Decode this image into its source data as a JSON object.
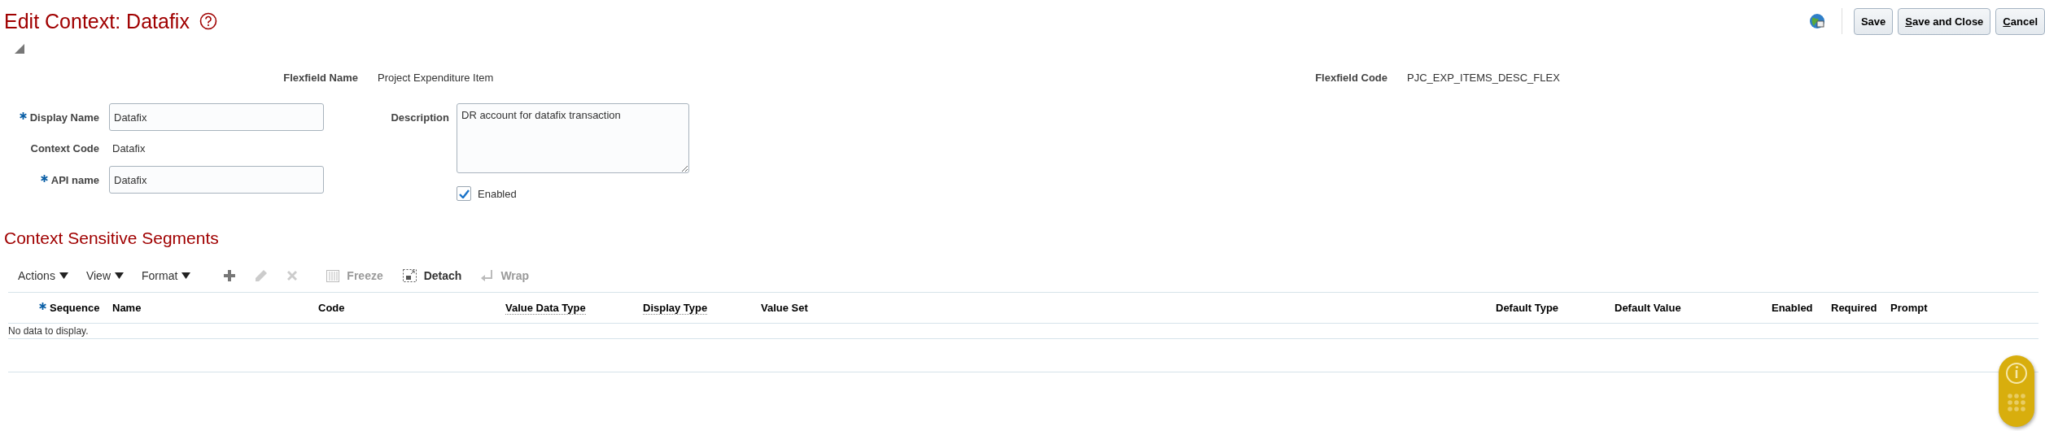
{
  "page": {
    "title": "Edit Context: Datafix"
  },
  "header_buttons": [
    {
      "label": "Save",
      "access_key": false
    },
    {
      "label": "Save and Close",
      "access_key": true
    },
    {
      "label": "Cancel",
      "access_key": true
    }
  ],
  "flexfield": {
    "name_label": "Flexfield Name",
    "name_value": "Project Expenditure Item",
    "code_label": "Flexfield Code",
    "code_value": "PJC_EXP_ITEMS_DESC_FLEX"
  },
  "form": {
    "display_name": {
      "label": "Display Name",
      "required": true,
      "value": "Datafix"
    },
    "context_code": {
      "label": "Context Code",
      "value": "Datafix"
    },
    "api_name": {
      "label": "API name",
      "required": true,
      "value": "Datafix"
    },
    "description": {
      "label": "Description",
      "value": "DR account for datafix transaction"
    },
    "enabled": {
      "label": "Enabled",
      "checked": true
    }
  },
  "section": {
    "title": "Context Sensitive Segments"
  },
  "toolbar": [
    {
      "kind": "menu",
      "label": "Actions",
      "disabled": false
    },
    {
      "kind": "menu",
      "label": "View",
      "disabled": false
    },
    {
      "kind": "menu",
      "label": "Format",
      "disabled": false
    },
    {
      "kind": "add",
      "disabled": false
    },
    {
      "kind": "edit",
      "disabled": true
    },
    {
      "kind": "delete",
      "disabled": true
    },
    {
      "kind": "freeze",
      "label": "Freeze",
      "disabled": true
    },
    {
      "kind": "detach",
      "label": "Detach",
      "disabled": false
    },
    {
      "kind": "wrap",
      "label": "Wrap",
      "disabled": true
    }
  ],
  "table": {
    "columns": [
      {
        "label": "Sequence",
        "required": true,
        "hint": false
      },
      {
        "label": "Name",
        "required": false,
        "hint": false
      },
      {
        "label": "Code",
        "required": false,
        "hint": false
      },
      {
        "label": "Value Data Type",
        "required": false,
        "hint": true
      },
      {
        "label": "Display Type",
        "required": false,
        "hint": true
      },
      {
        "label": "Value Set",
        "required": false,
        "hint": false
      },
      {
        "label": "Default Type",
        "required": false,
        "hint": false
      },
      {
        "label": "Default Value",
        "required": false,
        "hint": false
      },
      {
        "label": "Enabled",
        "required": false,
        "hint": false
      },
      {
        "label": "Required",
        "required": false,
        "hint": false
      },
      {
        "label": "Prompt",
        "required": false,
        "hint": false
      }
    ],
    "empty_message": "No data to display."
  }
}
